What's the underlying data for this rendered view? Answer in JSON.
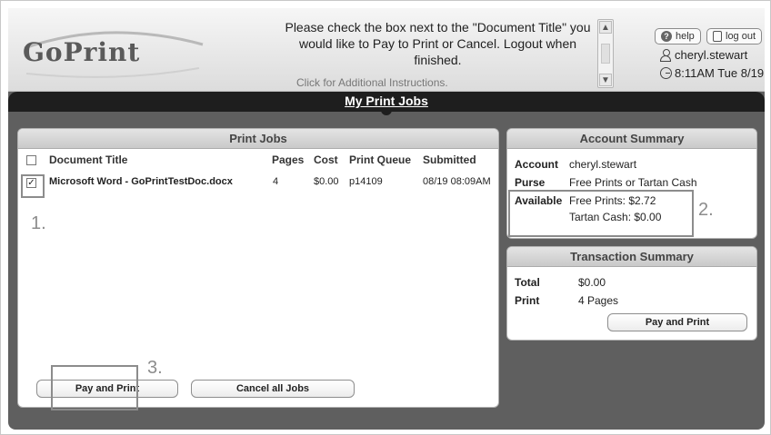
{
  "header": {
    "logo": "GoPrint",
    "instructions": "Please check the box next to the \"Document Title\" you would like to Pay to Print or Cancel. Logout when finished.",
    "instructions_link": "Click for Additional Instructions.",
    "help_label": "help",
    "logout_label": "log out",
    "username": "cheryl.stewart",
    "datetime": "8:11AM Tue 8/19"
  },
  "page_title": "My Print Jobs",
  "print_jobs": {
    "title": "Print Jobs",
    "columns": [
      "Document Title",
      "Pages",
      "Cost",
      "Print Queue",
      "Submitted"
    ],
    "rows": [
      {
        "checked": true,
        "title": "Microsoft Word - GoPrintTestDoc.docx",
        "pages": "4",
        "cost": "$0.00",
        "queue": "p14109",
        "submitted": "08/19 08:09AM"
      }
    ],
    "pay_button": "Pay and Print",
    "cancel_button": "Cancel all Jobs"
  },
  "account_summary": {
    "title": "Account Summary",
    "account_label": "Account",
    "account_value": "cheryl.stewart",
    "purse_label": "Purse",
    "purse_value": "Free Prints or Tartan Cash",
    "available_label": "Available",
    "free_prints": "Free Prints: $2.72",
    "tartan_cash": "Tartan Cash: $0.00"
  },
  "transaction_summary": {
    "title": "Transaction Summary",
    "total_label": "Total",
    "total_value": "$0.00",
    "print_label": "Print",
    "print_value": "4 Pages",
    "pay_button": "Pay and Print"
  },
  "steps": [
    "1.",
    "2.",
    "3."
  ]
}
